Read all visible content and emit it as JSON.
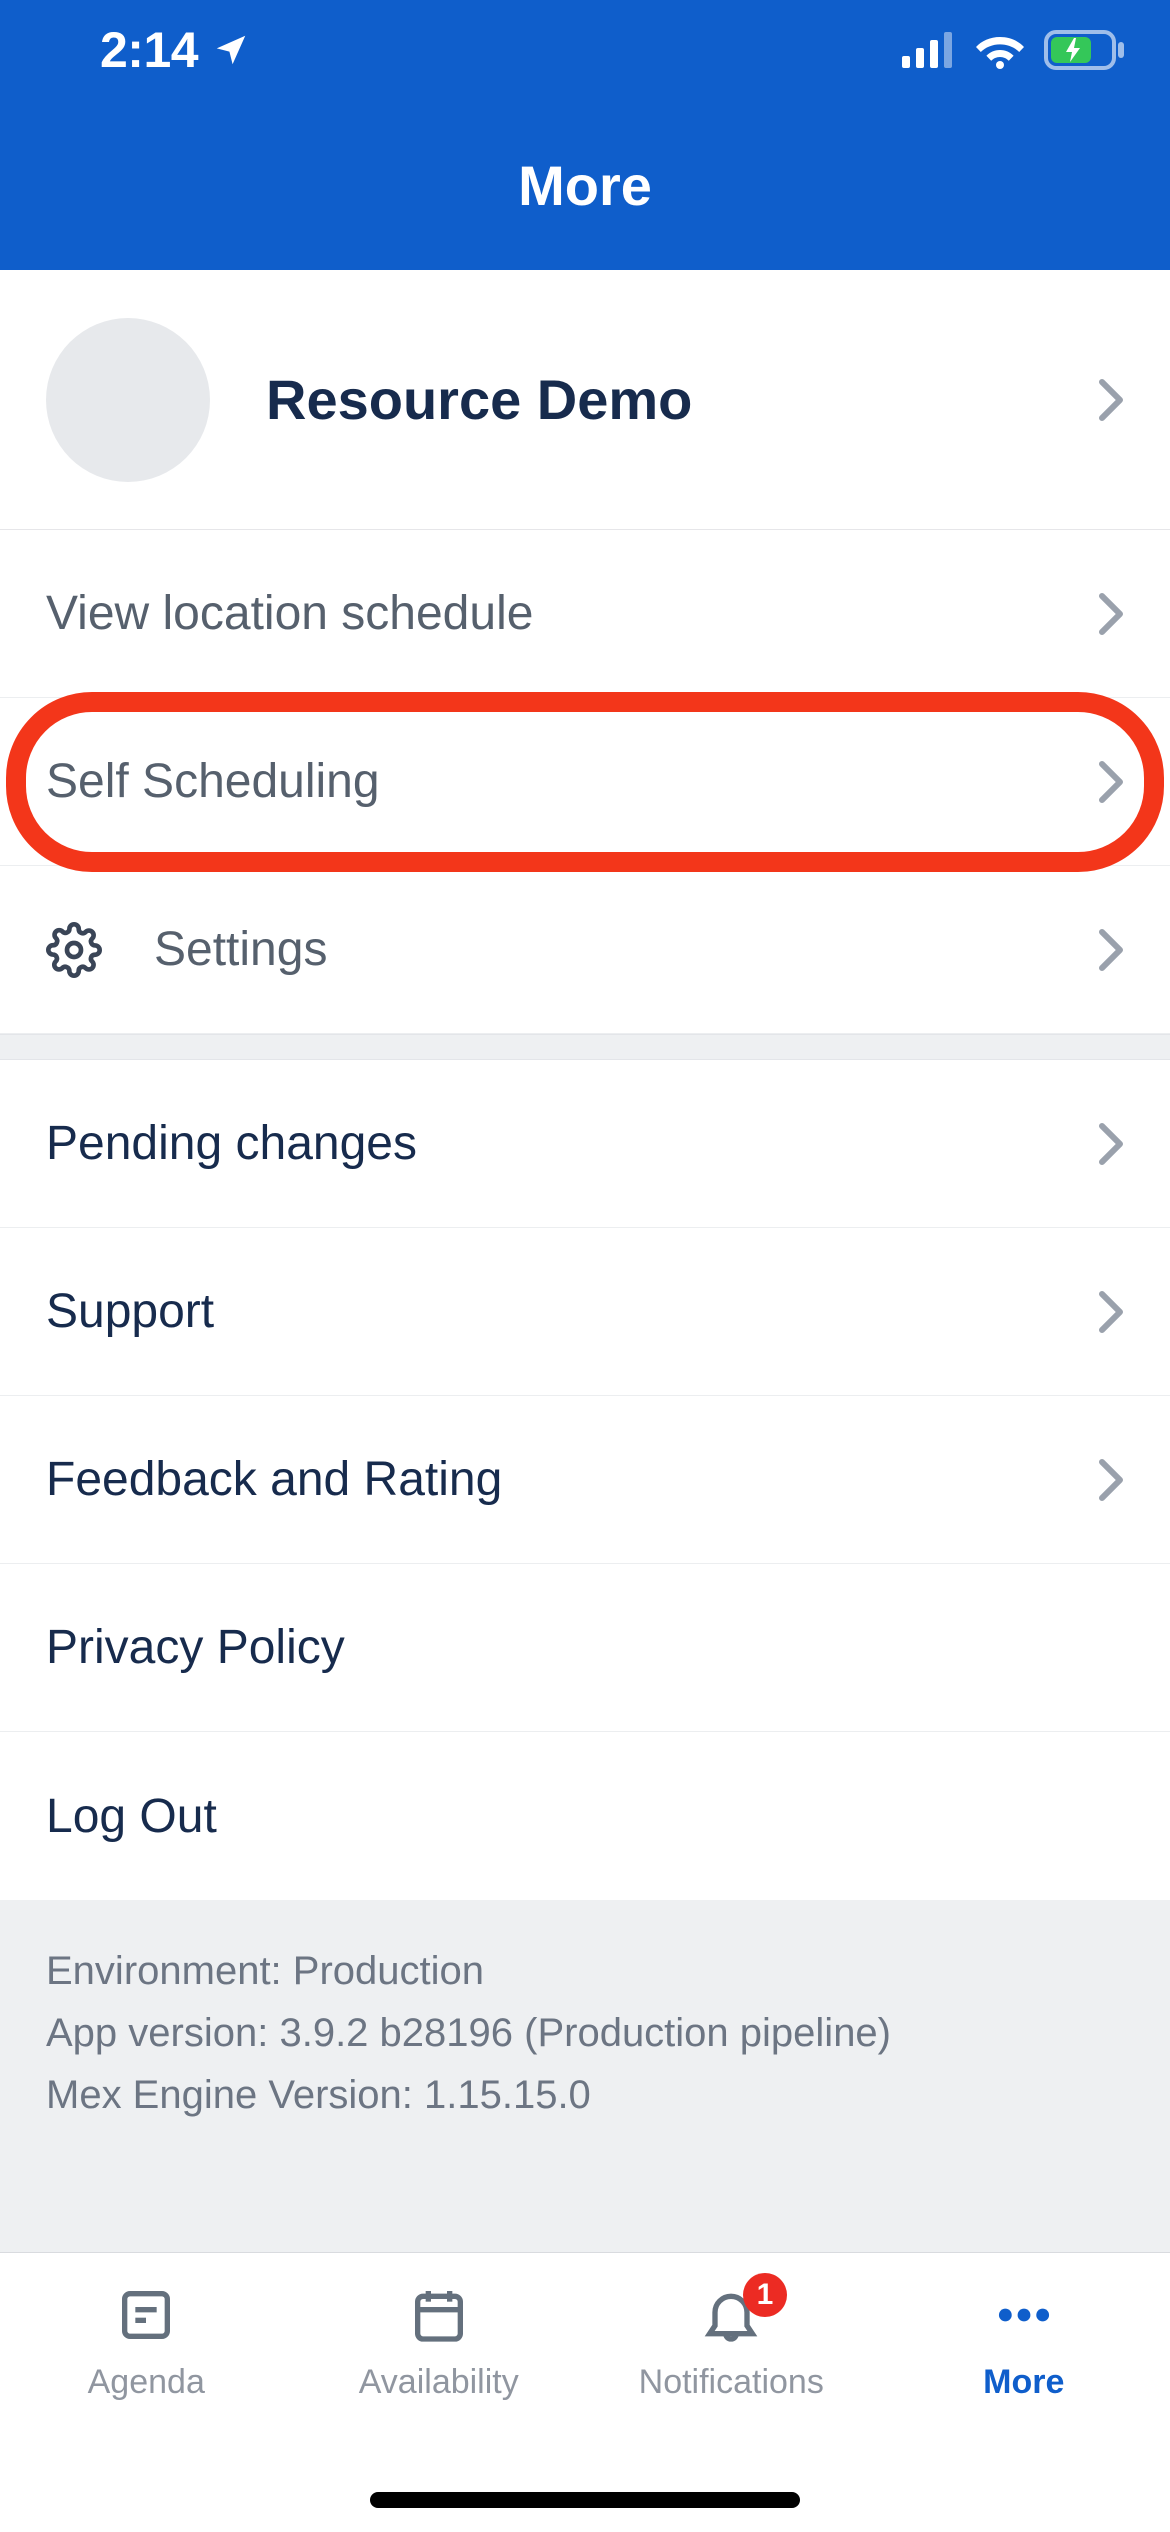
{
  "status": {
    "time": "2:14"
  },
  "header": {
    "title": "More"
  },
  "profile": {
    "name": "Resource Demo"
  },
  "section1": {
    "view_location": "View location schedule",
    "self_scheduling": "Self Scheduling",
    "settings": "Settings"
  },
  "section2": {
    "pending_changes": "Pending changes",
    "support": "Support",
    "feedback": "Feedback and Rating",
    "privacy": "Privacy Policy",
    "logout": "Log Out"
  },
  "footer": {
    "environment": "Environment: Production",
    "app_version": "App version: 3.9.2 b28196 (Production pipeline)",
    "mex_version": "Mex Engine Version: 1.15.15.0"
  },
  "tabs": {
    "agenda": "Agenda",
    "availability": "Availability",
    "notifications": "Notifications",
    "notifications_badge": "1",
    "more": "More"
  }
}
